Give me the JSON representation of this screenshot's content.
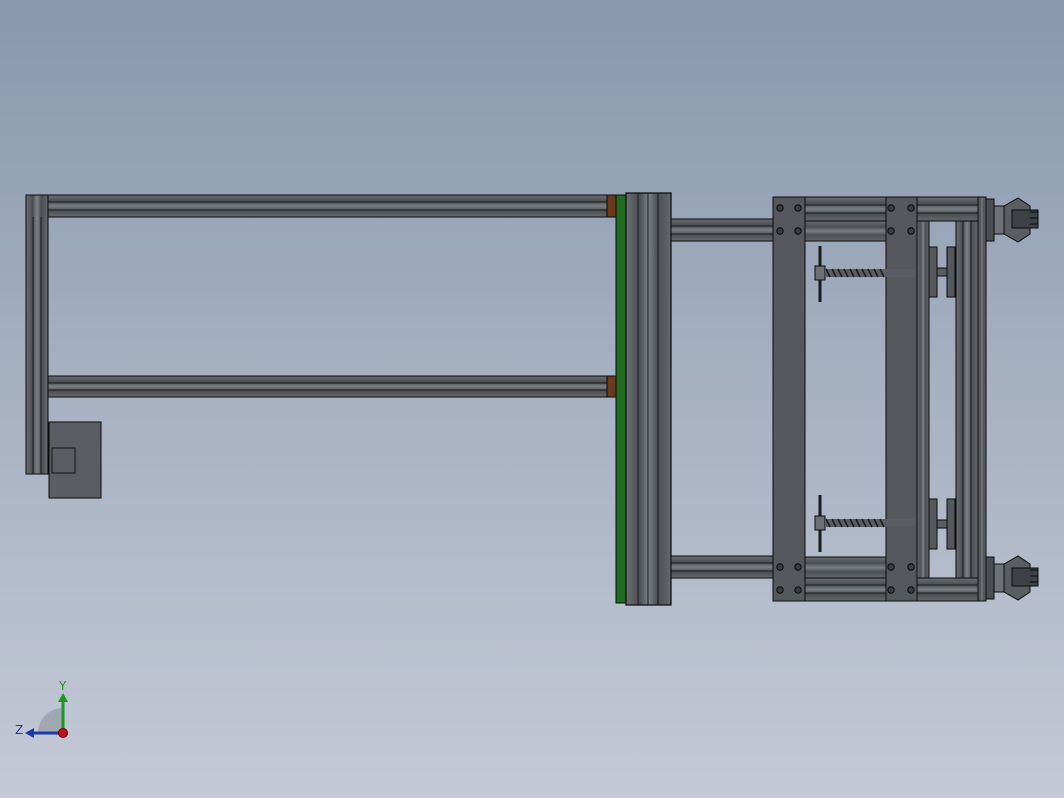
{
  "viewport": {
    "background_top": "#8898ad",
    "background_bottom": "#c4c9d6"
  },
  "model": {
    "frame_color": "#55595d",
    "frame_highlight": "#8a8f94",
    "edge_color": "#0a0a0a",
    "accent_green": "#1f6b1f",
    "accent_brown": "#6b3a1c"
  },
  "triad": {
    "y_label": "Y",
    "z_label": "Z",
    "y_color": "#1a9a1a",
    "z_color": "#1a3aa8",
    "x_color": "#c0141a"
  }
}
